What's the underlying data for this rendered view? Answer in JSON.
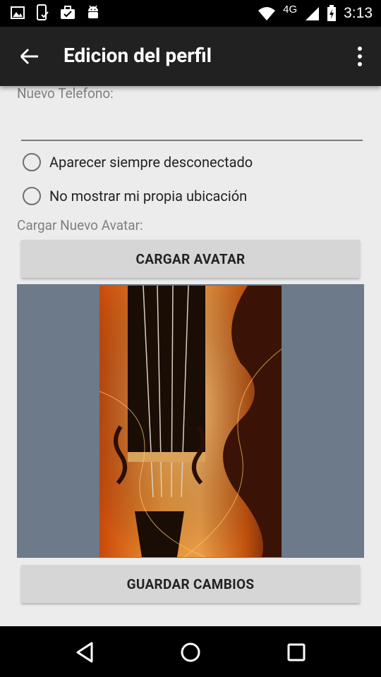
{
  "status_bar": {
    "network": "4G",
    "time": "3:13",
    "icons": [
      "image-icon",
      "phone-check-icon",
      "briefcase-check-icon",
      "android-icon",
      "wifi-icon",
      "signal-icon",
      "battery-icon"
    ]
  },
  "app_bar": {
    "title": "Edicion del perfil",
    "back_icon": "arrow-back-icon",
    "menu_icon": "overflow-menu-icon"
  },
  "form": {
    "phone_label": "Nuevo Telefono:",
    "phone_value": "",
    "option_offline": "Aparecer siempre desconectado",
    "option_location": "No mostrar mi propia ubicación",
    "avatar_label": "Cargar Nuevo Avatar:",
    "upload_button": "CARGAR AVATAR",
    "save_button": "GUARDAR CAMBIOS"
  },
  "colors": {
    "app_bar": "#212121",
    "background": "#ececec",
    "button": "#d6d6d6",
    "avatar_frame": "#6d7a89"
  },
  "nav_bar": {
    "icons": [
      "back-triangle-icon",
      "home-circle-icon",
      "recents-square-icon"
    ]
  }
}
